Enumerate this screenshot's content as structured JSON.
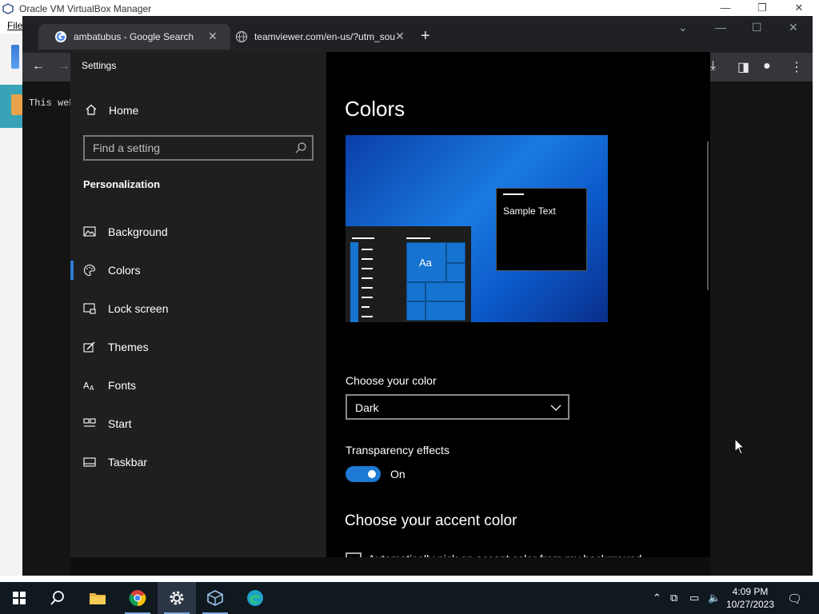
{
  "vbox": {
    "title": "Oracle VM VirtualBox Manager",
    "menu_file": "File",
    "controls": {
      "minimize": "—",
      "restore": "❐",
      "close": "✕"
    }
  },
  "chrome": {
    "tabs": [
      {
        "title": "ambatubus - Google Search",
        "icon": "google-icon",
        "active": true
      },
      {
        "title": "teamviewer.com/en-us/?utm_sou",
        "icon": "globe-icon",
        "active": false
      }
    ],
    "new_tab": "+",
    "page_text": "This web"
  },
  "settings": {
    "window_title": "Settings",
    "home_label": "Home",
    "search_placeholder": "Find a setting",
    "section_title": "Personalization",
    "nav": [
      {
        "label": "Background",
        "icon": "picture-icon",
        "selected": false
      },
      {
        "label": "Colors",
        "icon": "palette-icon",
        "selected": true
      },
      {
        "label": "Lock screen",
        "icon": "lock-screen-icon",
        "selected": false
      },
      {
        "label": "Themes",
        "icon": "brush-icon",
        "selected": false
      },
      {
        "label": "Fonts",
        "icon": "fonts-icon",
        "selected": false
      },
      {
        "label": "Start",
        "icon": "start-icon",
        "selected": false
      },
      {
        "label": "Taskbar",
        "icon": "taskbar-icon",
        "selected": false
      }
    ],
    "page_title": "Colors",
    "preview": {
      "sample_text": "Sample Text",
      "tile_text": "Aa"
    },
    "choose_color_label": "Choose your color",
    "choose_color_value": "Dark",
    "transparency_label": "Transparency effects",
    "transparency_state": "On",
    "accent_heading": "Choose your accent color",
    "auto_accent_text": "Automatically pick an accent color from my background",
    "accent_color": "#1e7ad4"
  },
  "taskbar": {
    "time": "4:09 PM",
    "date": "10/27/2023",
    "apps": [
      "windows-start-icon",
      "search-icon",
      "file-explorer-icon",
      "chrome-icon",
      "settings-gear-icon",
      "virtualbox-icon",
      "edge-icon"
    ]
  }
}
